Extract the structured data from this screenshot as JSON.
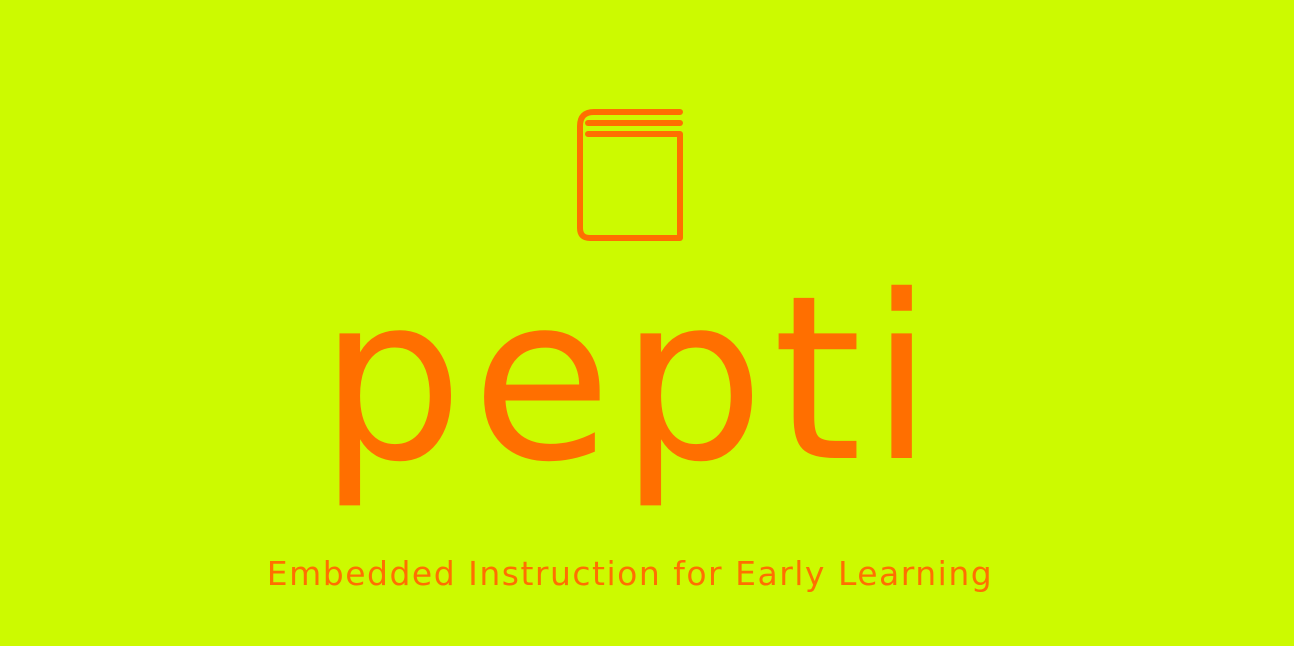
{
  "colors": {
    "background": "#ccfa00",
    "accent": "#ff6f00"
  },
  "logo": {
    "icon": "book-icon",
    "name": "pepti",
    "tagline": "Embedded Instruction for Early Learning"
  }
}
